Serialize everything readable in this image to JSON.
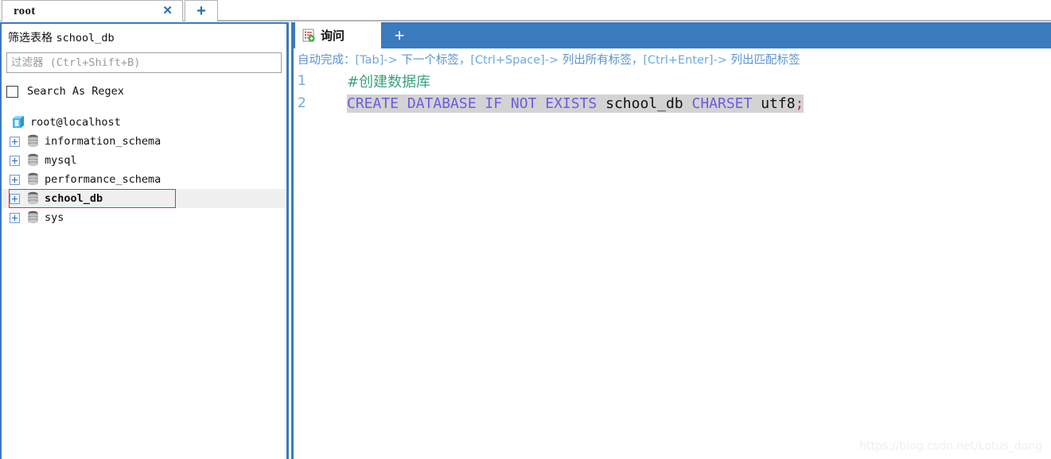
{
  "window": {
    "connection_tabs": [
      {
        "label": "root",
        "close_label": "✕",
        "active": true
      }
    ],
    "add_connection_label": "+"
  },
  "sidebar": {
    "filter_title_prefix": "筛选表格",
    "filter_title_target": "school_db",
    "filter_placeholder": "过滤器 (Ctrl+Shift+B)",
    "filter_value": "",
    "regex_checkbox_label": "Search As Regex",
    "regex_checked": false,
    "tree": {
      "root": {
        "label": "root@localhost",
        "icon": "server-icon"
      },
      "databases": [
        {
          "label": "information_schema",
          "icon": "database-icon",
          "expander": "+",
          "selected": false
        },
        {
          "label": "mysql",
          "icon": "database-icon",
          "expander": "+",
          "selected": false
        },
        {
          "label": "performance_schema",
          "icon": "database-icon",
          "expander": "+",
          "selected": false
        },
        {
          "label": "school_db",
          "icon": "database-icon",
          "expander": "+",
          "selected": true
        },
        {
          "label": "sys",
          "icon": "database-icon",
          "expander": "+",
          "selected": false
        }
      ]
    }
  },
  "editor": {
    "tabs": [
      {
        "label": "询问",
        "icon": "query-new-icon",
        "active": true
      }
    ],
    "add_tab_label": "+",
    "hint": {
      "prefix": "自动完成：",
      "segments": [
        {
          "key": "[Tab]->",
          "text": " 下一个标签，"
        },
        {
          "key": "[Ctrl+Space]->",
          "text": " 列出所有标签，"
        },
        {
          "key": "[Ctrl+Enter]->",
          "text": " 列出匹配标签"
        }
      ]
    },
    "lines": [
      {
        "number": "1",
        "highlighted": false,
        "tokens": [
          {
            "type": "comment",
            "text": "#创建数据库"
          }
        ]
      },
      {
        "number": "2",
        "highlighted": true,
        "tokens": [
          {
            "type": "kw",
            "text": "CREATE DATABASE IF NOT EXISTS "
          },
          {
            "type": "ident",
            "text": "school_db "
          },
          {
            "type": "kw",
            "text": "CHARSET "
          },
          {
            "type": "ident",
            "text": "utf8"
          },
          {
            "type": "semi",
            "text": ";"
          }
        ]
      }
    ]
  },
  "watermark": "https://blog.csdn.net/Lotus_dong",
  "colors": {
    "accent_blue": "#3b7abd",
    "tab_blue": "#2b6cb5",
    "hint_blue": "#5b93d6",
    "lineno_blue": "#6fa8e0",
    "comment_green": "#3aa37a",
    "keyword_purple": "#6b5ce0",
    "semicolon_red": "#c43030",
    "selection_outline_red": "#e03030",
    "selection_row_gray": "#f0f0f0",
    "code_highlight_gray": "#d3d3d3"
  }
}
